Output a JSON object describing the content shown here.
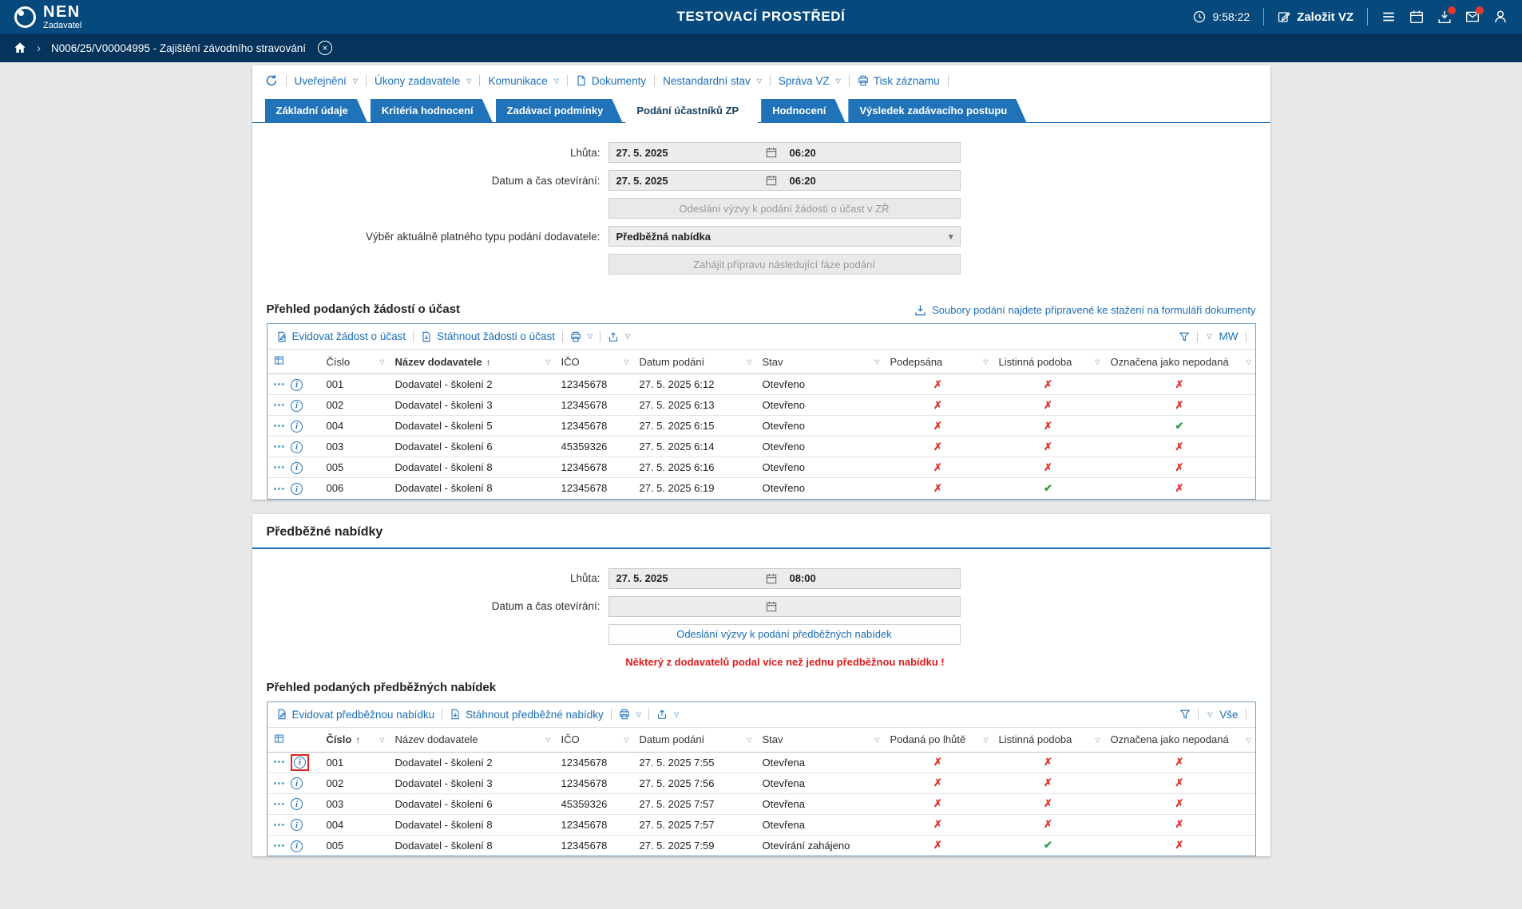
{
  "topbar": {
    "logo": "NEN",
    "logo_sub": "Zadavatel",
    "title": "TESTOVACÍ PROSTŘEDÍ",
    "clock": "9:58:22",
    "create_vz": "Založit VZ"
  },
  "breadcrumb": {
    "item": "N006/25/V00004995 - Zajištění závodního stravování"
  },
  "toolbar": {
    "items": [
      "Uveřejnění",
      "Úkony zadavatele",
      "Komunikace",
      "Dokumenty",
      "Nestandardní stav",
      "Správa VZ",
      "Tisk záznamu"
    ]
  },
  "tabs": [
    {
      "label": "Základní údaje",
      "active": false
    },
    {
      "label": "Kritéria hodnocení",
      "active": false
    },
    {
      "label": "Zadávací podmínky",
      "active": false
    },
    {
      "label": "Podání účastníků ZP",
      "active": true
    },
    {
      "label": "Hodnocení",
      "active": false
    },
    {
      "label": "Výsledek zadávacího postupu",
      "active": false
    }
  ],
  "section1": {
    "labels": {
      "lhuta": "Lhůta:",
      "otevirani": "Datum a čas otevírání:",
      "vyber": "Výběr aktuálně platného typu podání dodavatele:"
    },
    "lhuta_date": "27. 5. 2025",
    "lhuta_time": "06:20",
    "otevirani_date": "27. 5. 2025",
    "otevirani_time": "06:20",
    "vyber_value": "Předběžná nabídka",
    "btn_odeslani": "Odeslání výzvy k podání žádosti o účast v ZŘ",
    "btn_zahajit": "Zahájit přípravu následující fáze podání",
    "table_title": "Přehled podaných žádostí o účast",
    "download_link": "Soubory podání najdete připravené ke stažení na formuláři dokumenty",
    "table": {
      "actions": [
        "Evidovat žádost o účast",
        "Stáhnout žádosti o účast"
      ],
      "view_label": "MW",
      "columns": [
        "Číslo",
        "Název dodavatele",
        "IČO",
        "Datum podání",
        "Stav",
        "Podepsána",
        "Listinná podoba",
        "Označena jako nepodaná"
      ],
      "rows": [
        {
          "cells": [
            "001",
            "Dodavatel - školení 2",
            "12345678",
            "27. 5. 2025 6:12",
            "Otevřeno"
          ],
          "flags": [
            false,
            false,
            false
          ]
        },
        {
          "cells": [
            "002",
            "Dodavatel - školení 3",
            "12345678",
            "27. 5. 2025 6:13",
            "Otevřeno"
          ],
          "flags": [
            false,
            false,
            false
          ]
        },
        {
          "cells": [
            "004",
            "Dodavatel - školení 5",
            "12345678",
            "27. 5. 2025 6:15",
            "Otevřeno"
          ],
          "flags": [
            false,
            false,
            true
          ]
        },
        {
          "cells": [
            "003",
            "Dodavatel - školení 6",
            "45359326",
            "27. 5. 2025 6:14",
            "Otevřeno"
          ],
          "flags": [
            false,
            false,
            false
          ]
        },
        {
          "cells": [
            "005",
            "Dodavatel - školení 8",
            "12345678",
            "27. 5. 2025 6:16",
            "Otevřeno"
          ],
          "flags": [
            false,
            false,
            false
          ]
        },
        {
          "cells": [
            "006",
            "Dodavatel - školení 8",
            "12345678",
            "27. 5. 2025 6:19",
            "Otevřeno"
          ],
          "flags": [
            false,
            true,
            false
          ]
        }
      ]
    }
  },
  "section2": {
    "title": "Předběžné nabídky",
    "labels": {
      "lhuta": "Lhůta:",
      "otevirani": "Datum a čas otevírání:"
    },
    "lhuta_date": "27. 5. 2025",
    "lhuta_time": "08:00",
    "otevirani_date": "",
    "otevirani_time": "",
    "btn_odeslani": "Odeslání výzvy k podání předběžných nabídek",
    "warning": "Některý z dodavatelů podal více než jednu předběžnou nabídku !",
    "table_title": "Přehled podaných předběžných nabídek",
    "table": {
      "actions": [
        "Evidovat předběžnou nabídku",
        "Stáhnout předběžné nabídky"
      ],
      "view_label": "Vše",
      "columns": [
        "Číslo",
        "Název dodavatele",
        "IČO",
        "Datum podání",
        "Stav",
        "Podaná po lhůtě",
        "Listinná podoba",
        "Označena jako nepodaná"
      ],
      "rows": [
        {
          "cells": [
            "001",
            "Dodavatel - školení 2",
            "12345678",
            "27. 5. 2025 7:55",
            "Otevřena"
          ],
          "flags": [
            false,
            false,
            false
          ],
          "hl": true
        },
        {
          "cells": [
            "002",
            "Dodavatel - školení 3",
            "12345678",
            "27. 5. 2025 7:56",
            "Otevřena"
          ],
          "flags": [
            false,
            false,
            false
          ]
        },
        {
          "cells": [
            "003",
            "Dodavatel - školení 6",
            "45359326",
            "27. 5. 2025 7:57",
            "Otevřena"
          ],
          "flags": [
            false,
            false,
            false
          ]
        },
        {
          "cells": [
            "004",
            "Dodavatel - školení 8",
            "12345678",
            "27. 5. 2025 7:57",
            "Otevřena"
          ],
          "flags": [
            false,
            false,
            false
          ]
        },
        {
          "cells": [
            "005",
            "Dodavatel - školení 8",
            "12345678",
            "27. 5. 2025 7:59",
            "Otevírání zahájeno"
          ],
          "flags": [
            false,
            true,
            false
          ]
        }
      ]
    }
  },
  "glyphs": {
    "yes": "✔",
    "no": "✗",
    "dots": "•••",
    "caret": "▽",
    "sort_asc": "↑",
    "chevron": "›",
    "close": "×",
    "select_chevron": "▾",
    "info": "i"
  }
}
